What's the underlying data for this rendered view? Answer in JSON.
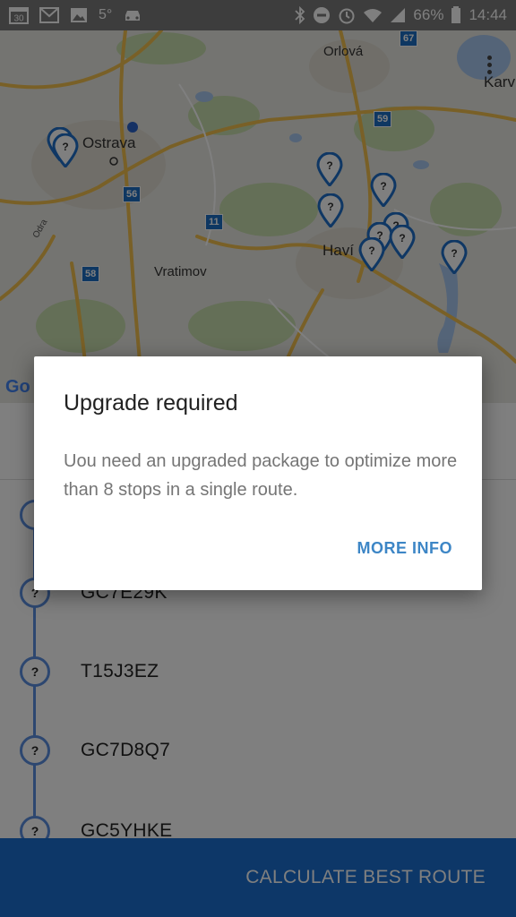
{
  "status_bar": {
    "notifications": [
      "calendar-icon",
      "gmail-icon",
      "gallery-icon"
    ],
    "temperature": "5°",
    "car_icon": "car-icon",
    "icons_right": [
      "bluetooth-icon",
      "do-not-disturb-icon",
      "alarm-icon",
      "wifi-icon",
      "signal-icon"
    ],
    "battery": "66%",
    "time": "14:44",
    "calendar_day": "30"
  },
  "map": {
    "labels": {
      "ostrava": "Ostrava",
      "orlova": "Orlová",
      "vratimov": "Vratimov",
      "havirov": "Haví",
      "karvina": "Karv",
      "odra": "Odra"
    },
    "route_badges": {
      "r56": "56",
      "r11": "11",
      "r58": "58",
      "r59": "59",
      "r67": "67"
    },
    "pin_glyph": "?",
    "google_logo": "Go",
    "colors": {
      "pin": "#1e6fc8",
      "road": "#f2c14e",
      "water": "#a9c8f0",
      "park": "#c8dfae"
    }
  },
  "stops": [
    {
      "code": "GC7E29K",
      "marker": "?"
    },
    {
      "code": "T15J3EZ",
      "marker": "?"
    },
    {
      "code": "GC7D8Q7",
      "marker": "?"
    },
    {
      "code": "GC5YHKE",
      "marker": "?"
    }
  ],
  "bottom_bar": {
    "calculate_label": "CALCULATE BEST ROUTE",
    "color": "#1a6fd1"
  },
  "dialog": {
    "title": "Upgrade required",
    "message": "Uou need an upgraded package to optimize more than 8 stops in a single route.",
    "action_label": "MORE INFO",
    "accent": "#3d86c6"
  }
}
